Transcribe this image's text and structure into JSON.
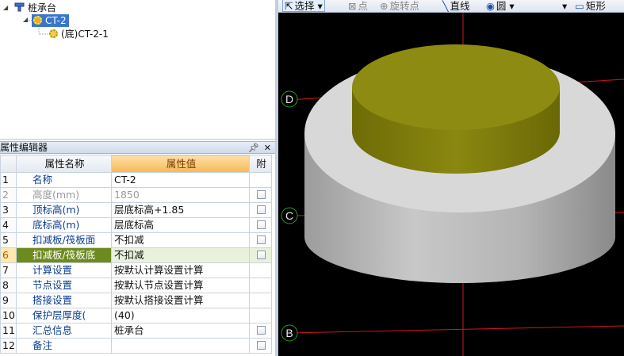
{
  "tree": {
    "root_label": "桩承台",
    "child_label": "CT-2",
    "grandchild_label": "(底)CT-2-1"
  },
  "property_editor": {
    "title": "属性编辑器",
    "pin_icon": "pin-icon",
    "close_icon": "close-icon",
    "columns": {
      "name": "属性名称",
      "value": "属性值",
      "attach": "附"
    },
    "rows": [
      {
        "idx": "1",
        "name": "名称",
        "value": "CT-2",
        "checkbox": false
      },
      {
        "idx": "2",
        "name": "高度(mm)",
        "value": "1850",
        "checkbox": true,
        "disabled": true
      },
      {
        "idx": "3",
        "name": "顶标高(m)",
        "value": "层底标高+1.85",
        "checkbox": true
      },
      {
        "idx": "4",
        "name": "底标高(m)",
        "value": "层底标高",
        "checkbox": true
      },
      {
        "idx": "5",
        "name": "扣减板/筏板面",
        "value": "不扣减",
        "checkbox": true
      },
      {
        "idx": "6",
        "name": "扣减板/筏板底",
        "value": "不扣减",
        "checkbox": true,
        "selected": true
      },
      {
        "idx": "7",
        "name": "计算设置",
        "value": "按默认计算设置计算",
        "checkbox": false
      },
      {
        "idx": "8",
        "name": "节点设置",
        "value": "按默认节点设置计算",
        "checkbox": false
      },
      {
        "idx": "9",
        "name": "搭接设置",
        "value": "按默认搭接设置计算",
        "checkbox": false
      },
      {
        "idx": "10",
        "name": "保护层厚度(",
        "value": "(40)",
        "checkbox": false
      },
      {
        "idx": "11",
        "name": "汇总信息",
        "value": "桩承台",
        "checkbox": true
      },
      {
        "idx": "12",
        "name": "备注",
        "value": "",
        "checkbox": true
      }
    ]
  },
  "toolbar": {
    "select_label": "选择",
    "point_label": "点",
    "rotate_point_label": "旋转点",
    "line_label": "直线",
    "circle_label": "圆",
    "rect_label": "矩形"
  },
  "viewport": {
    "axis_labels": [
      "D",
      "C",
      "B"
    ],
    "colors": {
      "background": "#000000",
      "pile_cap_side": "#b4b4b4",
      "pile_cap_top": "#dcdcdc",
      "top_disc": "#8c8a10",
      "axis_line": "#d01818",
      "axis_marker": "#1fa01f"
    }
  }
}
